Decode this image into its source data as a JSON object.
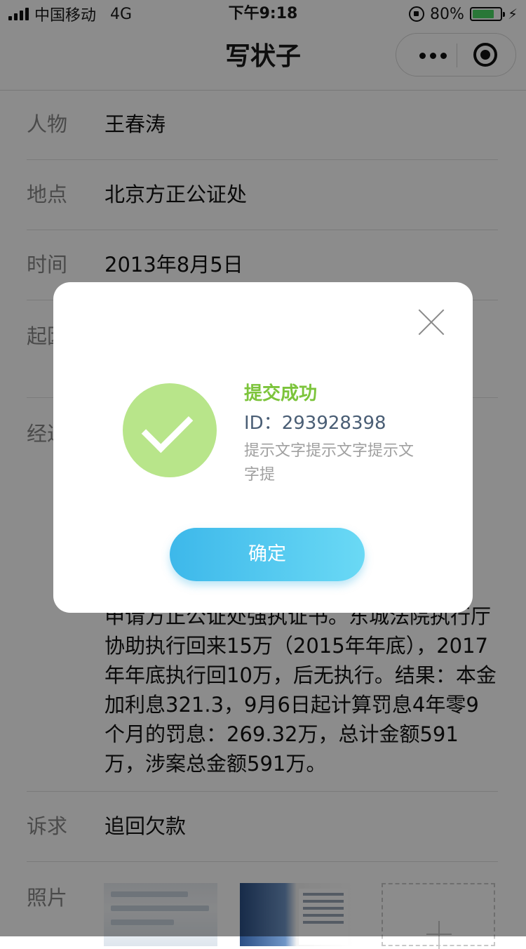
{
  "status_bar": {
    "carrier": "中国移动",
    "network": "4G",
    "time": "下午9:18",
    "battery_percent": "80%",
    "battery_level": 0.8,
    "icons": [
      "signal-icon",
      "orientation-lock-icon",
      "battery-icon",
      "charging-icon"
    ]
  },
  "nav": {
    "title": "写状子",
    "icons": [
      "more-icon",
      "close-miniprogram-icon"
    ]
  },
  "form": {
    "person_label": "人物",
    "person_value": "王春涛",
    "place_label": "地点",
    "place_value": "北京方正公证处",
    "time_label": "时间",
    "time_value": "2013年8月5日",
    "cause_label": "起因",
    "process_label": "经过",
    "process_value_visible": "申请方正公证处强执证书。东城法院执行厅协助执行回来15万（2015年年底），2017年年底执行回10万，后无执行。结果：本金加利息321.3，9月6日起计算罚息4年零9个月的罚息：269.32万，总计金额591万，涉案总金额591万。",
    "claim_label": "诉求",
    "claim_value": "追回欠款",
    "photos_label": "照片"
  },
  "modal": {
    "title": "提交成功",
    "id_text": "ID：293928398",
    "hint": "提示文字提示文字提示文字提",
    "confirm_label": "确定",
    "success_color": "#7cc43b",
    "button_color": "#3db8ea"
  }
}
